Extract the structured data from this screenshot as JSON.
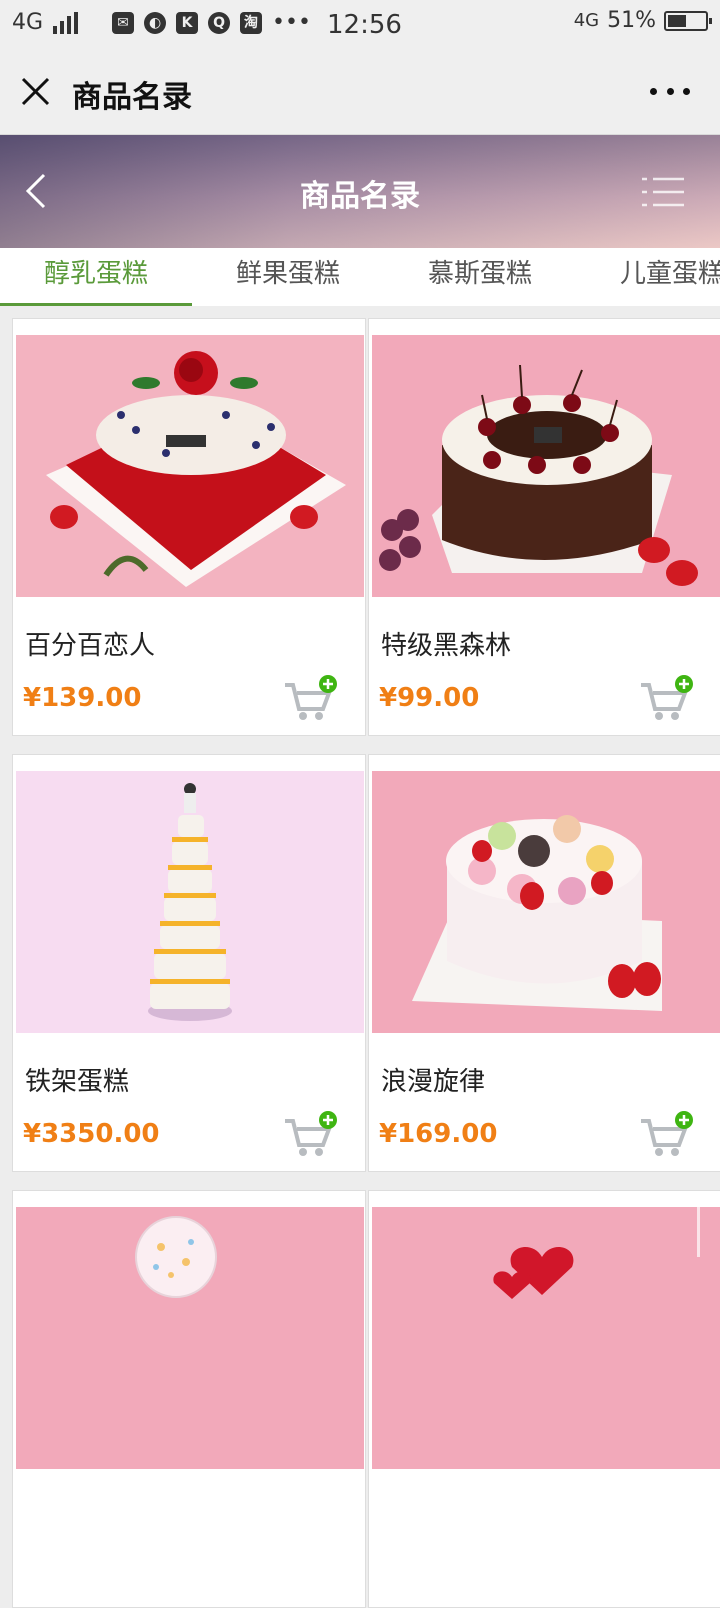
{
  "status_bar": {
    "network": "4G",
    "apps": [
      "mail-icon",
      "browser-icon",
      "k-app-icon",
      "q-app-icon",
      "taobao-icon"
    ],
    "app_glyphs": [
      "✉",
      "◐",
      "K",
      "Q",
      "淘"
    ],
    "more": "•••",
    "time": "12:56",
    "network_right": "4G",
    "battery_text": "51%",
    "battery_level": 0.51
  },
  "nav": {
    "title": "商品名录"
  },
  "banner": {
    "title": "商品名录"
  },
  "tabs": [
    {
      "label": "醇乳蛋糕",
      "active": true
    },
    {
      "label": "鲜果蛋糕",
      "active": false
    },
    {
      "label": "慕斯蛋糕",
      "active": false
    },
    {
      "label": "儿童蛋糕",
      "active": false
    }
  ],
  "products": [
    {
      "name": "百分百恋人",
      "price": "¥139.00",
      "image": "cake-photo-rose-heart"
    },
    {
      "name": "特级黑森林",
      "price": "¥99.00",
      "image": "cake-photo-black-forest"
    },
    {
      "name": "铁架蛋糕",
      "price": "¥3350.00",
      "image": "cake-photo-tiered"
    },
    {
      "name": "浪漫旋律",
      "price": "¥169.00",
      "image": "cake-photo-macaron"
    },
    {
      "name": "",
      "price": "",
      "image": "cake-photo-balloon"
    },
    {
      "name": "",
      "price": "",
      "image": "cake-photo-hearts"
    }
  ],
  "colors": {
    "accent_green": "#5a9a3a",
    "price_orange": "#f07f15",
    "cart_gray": "#b8bcc0",
    "badge_green": "#3fb512"
  }
}
